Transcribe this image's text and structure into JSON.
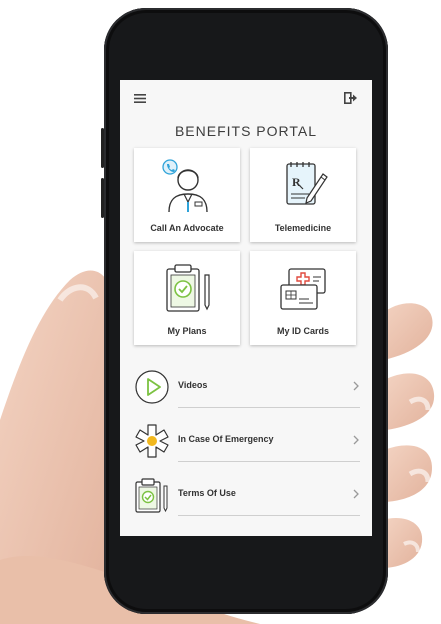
{
  "header": {
    "menu_icon": "hamburger-icon",
    "logout_icon": "logout-icon"
  },
  "portal": {
    "title": "BENEFITS PORTAL"
  },
  "tiles": [
    {
      "label": "Call An Advocate",
      "icon": "advocate-person-icon"
    },
    {
      "label": "Telemedicine",
      "icon": "prescription-pen-icon"
    },
    {
      "label": "My Plans",
      "icon": "clipboard-check-icon"
    },
    {
      "label": "My ID Cards",
      "icon": "id-cards-icon"
    }
  ],
  "list": [
    {
      "label": "Videos",
      "icon": "play-circle-icon"
    },
    {
      "label": "In Case Of Emergency",
      "icon": "medical-star-icon"
    },
    {
      "label": "Terms Of Use",
      "icon": "clipboard-pen-icon"
    }
  ],
  "colors": {
    "accent_green": "#7cc242",
    "accent_blue": "#2ea3d9",
    "accent_red": "#e04a3f",
    "accent_yellow": "#f2b81e",
    "screen_bg": "#f7f7f7"
  }
}
